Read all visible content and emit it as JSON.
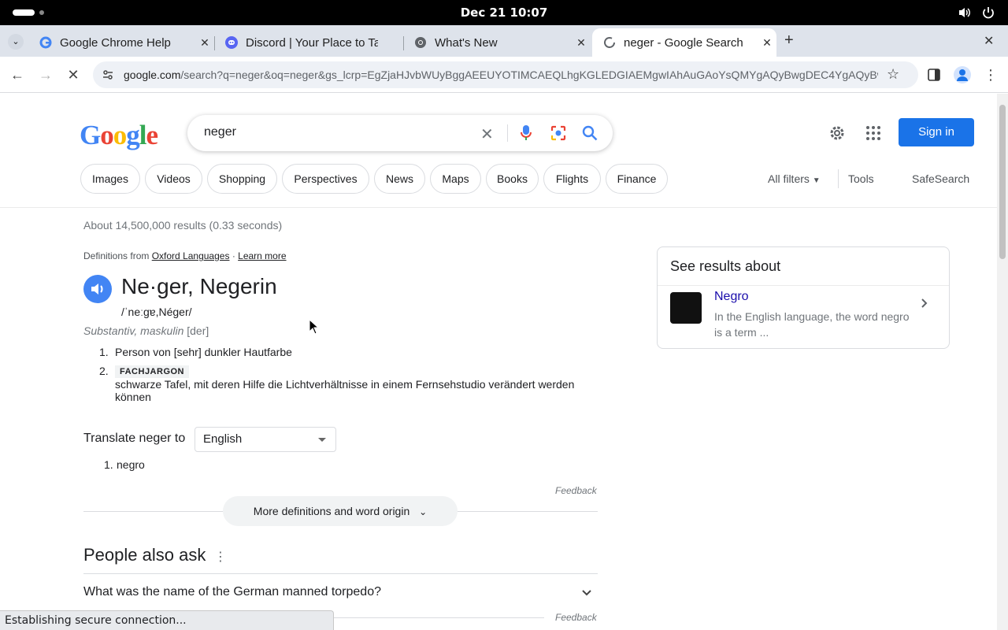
{
  "system": {
    "clock": "Dec 21  10:07"
  },
  "tabs": [
    {
      "title": "Google Chrome Help",
      "icon": "google-g-icon"
    },
    {
      "title": "Discord | Your Place to Talk",
      "icon": "discord-icon"
    },
    {
      "title": "What's New",
      "icon": "chrome-icon"
    },
    {
      "title": "neger - Google Search",
      "icon": "loading-icon",
      "active": true
    }
  ],
  "address_bar": {
    "host": "google.com",
    "path": "/search?q=neger&oq=neger&gs_lcrp=EgZjaHJvbWUyBggAEEUYOTIMCAEQLhgKGLEDGIAEMgwIAhAuGAoYsQMYgAQyBwgDEC4YgAQyBw..."
  },
  "google": {
    "query": "neger",
    "sign_in": "Sign in",
    "chips": [
      "Images",
      "Videos",
      "Shopping",
      "Perspectives",
      "News",
      "Maps",
      "Books",
      "Flights",
      "Finance"
    ],
    "all_filters": "All filters",
    "tools": "Tools",
    "safesearch": "SafeSearch",
    "stats": "About 14,500,000 results (0.33 seconds)"
  },
  "definition": {
    "source_prefix": "Definitions from",
    "source": "Oxford Languages",
    "separator": "·",
    "learn_more": "Learn more",
    "headword": "Ne·ger, Negerin",
    "phonetic": "/ˈneːɡɐ,Néger/",
    "pos": "Substantiv, maskulin",
    "gender": "[der]",
    "senses": [
      {
        "num": "1.",
        "text": "Person von [sehr] dunkler Hautfarbe"
      },
      {
        "num": "2.",
        "tag": "FACHJARGON",
        "text": "schwarze Tafel, mit deren Hilfe die Lichtverhältnisse in einem Fernsehstudio verändert werden können"
      }
    ],
    "translate_label": "Translate neger to",
    "translate_lang": "English",
    "translations": [
      {
        "num": "1.",
        "text": "negro"
      }
    ],
    "feedback": "Feedback",
    "more": "More definitions and word origin"
  },
  "paa": {
    "title": "People also ask",
    "questions": [
      "What was the name of the German manned torpedo?"
    ],
    "feedback": "Feedback"
  },
  "knowledge_panel": {
    "heading": "See results about",
    "name": "Negro",
    "description": "In the English language, the word negro is a term ..."
  },
  "statusbar": {
    "text": "Establishing secure connection..."
  },
  "colors": {
    "accent": "#1a73e8",
    "link": "#1a0dab",
    "tabstrip": "#dee3eb"
  }
}
